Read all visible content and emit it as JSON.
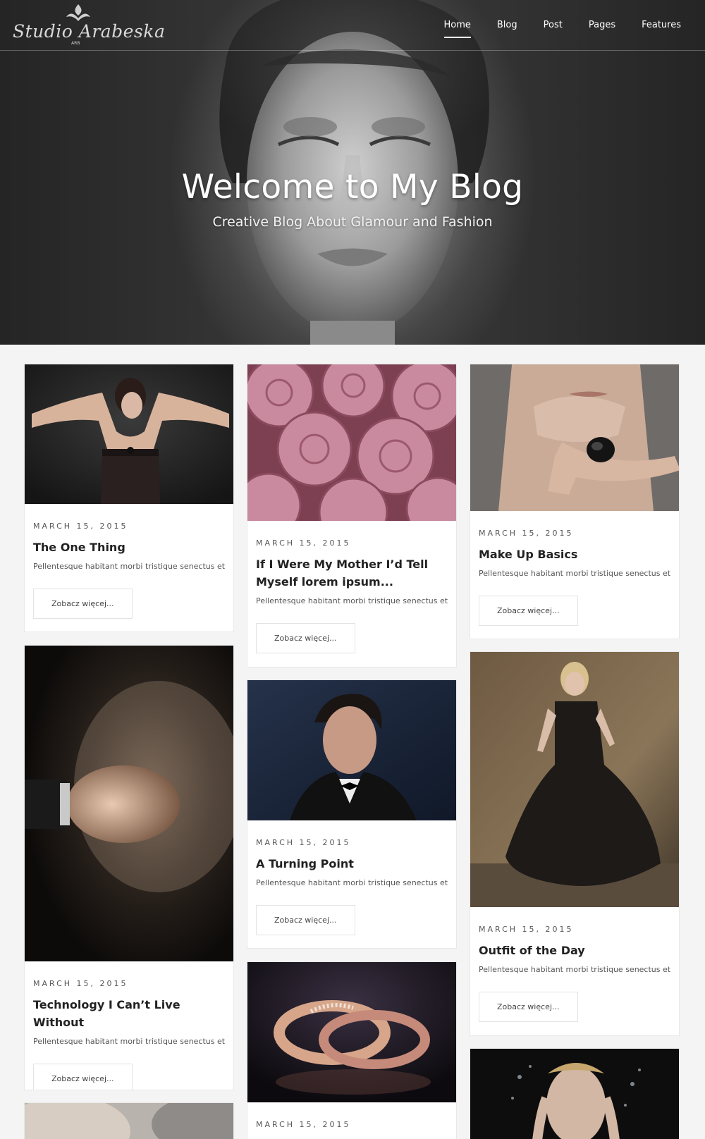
{
  "brand": {
    "logo_text": "Studio Arabeska",
    "logo_sub": "ARB"
  },
  "nav": {
    "items": [
      "Home",
      "Blog",
      "Post",
      "Pages",
      "Features"
    ],
    "active": "Home"
  },
  "hero": {
    "title": "Welcome to My Blog",
    "subtitle": "Creative Blog About Glamour and Fashion"
  },
  "read_more": "Zobacz więcej...",
  "posts": [
    {
      "date": "March 15, 2015",
      "title": "The One Thing",
      "excerpt": "Pellentesque habitant morbi tristique senectus et n",
      "image": "woman-in-black-dress-photo"
    },
    {
      "date": "March 15, 2015",
      "title": "If I Were My Mother I’d Tell Myself lorem ipsum...",
      "excerpt": "Pellentesque habitant morbi tristique senectus et n",
      "image": "pink-roses-photo"
    },
    {
      "date": "March 15, 2015",
      "title": "Make Up Basics",
      "excerpt": "Pellentesque habitant morbi tristique senectus et n",
      "image": "woman-with-ring-photo"
    },
    {
      "date": "March 15, 2015",
      "title": "Technology I Can’t Live Without",
      "excerpt": "Pellentesque habitant morbi tristique senectus et n",
      "image": "makeup-brush-powder-photo"
    },
    {
      "date": "March 15, 2015",
      "title": "A Turning Point",
      "excerpt": "Pellentesque habitant morbi tristique senectus et n",
      "image": "man-in-tuxedo-photo"
    },
    {
      "date": "March 15, 2015",
      "title": "Outfit of the Day",
      "excerpt": "Pellentesque habitant morbi tristique senectus et n",
      "image": "woman-in-flowing-dress-photo"
    },
    {
      "date": "March 15, 2015",
      "title": "",
      "excerpt": "",
      "image": "gold-rings-photo"
    },
    {
      "date": "",
      "title": "",
      "excerpt": "",
      "image": "woman-with-water-splash-photo"
    },
    {
      "date": "",
      "title": "",
      "excerpt": "",
      "image": "skin-closeup-photo"
    }
  ]
}
